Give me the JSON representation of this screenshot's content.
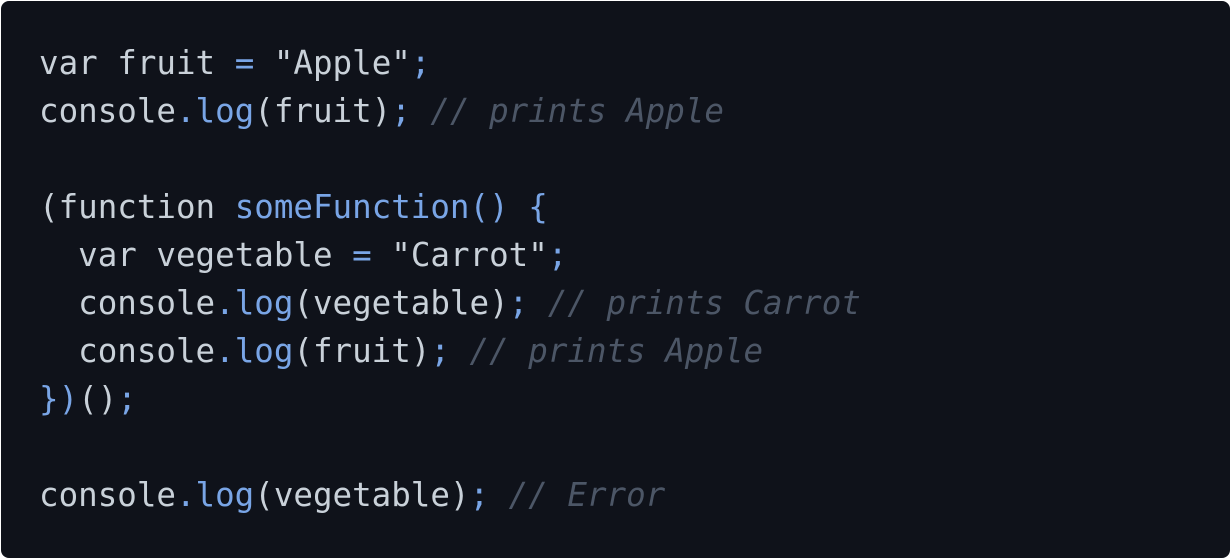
{
  "colors": {
    "background": "#0f121a",
    "text": "#c9d1d9",
    "accent": "#79a5e6",
    "comment": "#4c5666"
  },
  "lines": [
    [
      {
        "t": "var",
        "c": "kw"
      },
      {
        "t": " ",
        "c": "ident"
      },
      {
        "t": "fruit",
        "c": "ident"
      },
      {
        "t": " ",
        "c": "ident"
      },
      {
        "t": "=",
        "c": "op"
      },
      {
        "t": " ",
        "c": "ident"
      },
      {
        "t": "\"Apple\"",
        "c": "str"
      },
      {
        "t": ";",
        "c": "op"
      }
    ],
    [
      {
        "t": "console",
        "c": "ident"
      },
      {
        "t": ".",
        "c": "dot"
      },
      {
        "t": "log",
        "c": "fn"
      },
      {
        "t": "(",
        "c": "punct"
      },
      {
        "t": "fruit",
        "c": "ident"
      },
      {
        "t": ")",
        "c": "punct"
      },
      {
        "t": ";",
        "c": "op"
      },
      {
        "t": " ",
        "c": "ident"
      },
      {
        "t": "// prints Apple",
        "c": "comment"
      }
    ],
    [],
    [
      {
        "t": "(",
        "c": "punct"
      },
      {
        "t": "function",
        "c": "kw"
      },
      {
        "t": " ",
        "c": "ident"
      },
      {
        "t": "someFunction",
        "c": "fn"
      },
      {
        "t": "()",
        "c": "fn"
      },
      {
        "t": " ",
        "c": "ident"
      },
      {
        "t": "{",
        "c": "op"
      }
    ],
    [
      {
        "t": "  ",
        "c": "ident"
      },
      {
        "t": "var",
        "c": "kw"
      },
      {
        "t": " ",
        "c": "ident"
      },
      {
        "t": "vegetable",
        "c": "ident"
      },
      {
        "t": " ",
        "c": "ident"
      },
      {
        "t": "=",
        "c": "op"
      },
      {
        "t": " ",
        "c": "ident"
      },
      {
        "t": "\"Carrot\"",
        "c": "str"
      },
      {
        "t": ";",
        "c": "op"
      }
    ],
    [
      {
        "t": "  ",
        "c": "ident"
      },
      {
        "t": "console",
        "c": "ident"
      },
      {
        "t": ".",
        "c": "dot"
      },
      {
        "t": "log",
        "c": "fn"
      },
      {
        "t": "(",
        "c": "punct"
      },
      {
        "t": "vegetable",
        "c": "ident"
      },
      {
        "t": ")",
        "c": "punct"
      },
      {
        "t": ";",
        "c": "op"
      },
      {
        "t": " ",
        "c": "ident"
      },
      {
        "t": "// prints Carrot",
        "c": "comment"
      }
    ],
    [
      {
        "t": "  ",
        "c": "ident"
      },
      {
        "t": "console",
        "c": "ident"
      },
      {
        "t": ".",
        "c": "dot"
      },
      {
        "t": "log",
        "c": "fn"
      },
      {
        "t": "(",
        "c": "punct"
      },
      {
        "t": "fruit",
        "c": "ident"
      },
      {
        "t": ")",
        "c": "punct"
      },
      {
        "t": ";",
        "c": "op"
      },
      {
        "t": " ",
        "c": "ident"
      },
      {
        "t": "// prints Apple",
        "c": "comment"
      }
    ],
    [
      {
        "t": "})",
        "c": "op"
      },
      {
        "t": "()",
        "c": "punct"
      },
      {
        "t": ";",
        "c": "op"
      }
    ],
    [],
    [
      {
        "t": "console",
        "c": "ident"
      },
      {
        "t": ".",
        "c": "dot"
      },
      {
        "t": "log",
        "c": "fn"
      },
      {
        "t": "(",
        "c": "punct"
      },
      {
        "t": "vegetable",
        "c": "ident"
      },
      {
        "t": ")",
        "c": "punct"
      },
      {
        "t": ";",
        "c": "op"
      },
      {
        "t": " ",
        "c": "ident"
      },
      {
        "t": "// Error",
        "c": "comment"
      }
    ]
  ]
}
